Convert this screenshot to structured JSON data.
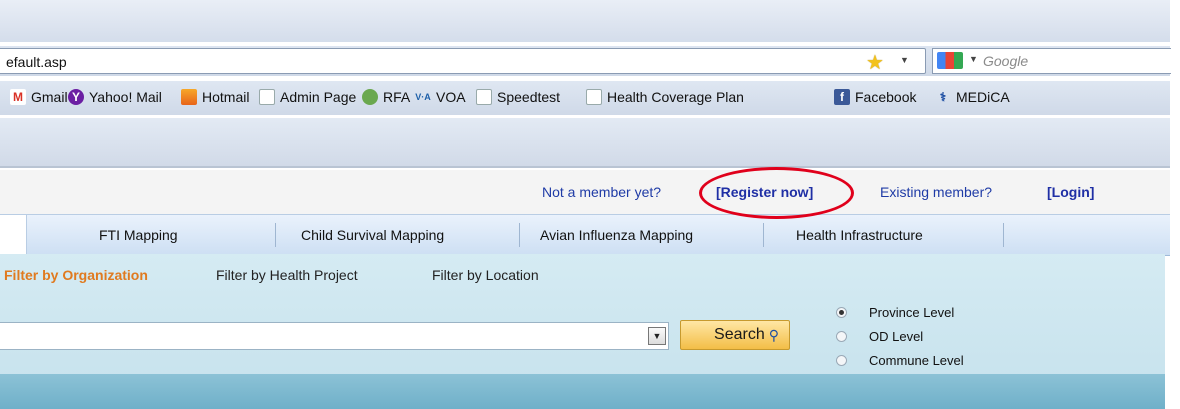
{
  "browser": {
    "address": "efault.asp",
    "search_placeholder": "Google"
  },
  "bookmarks": [
    {
      "label": "Gmail",
      "icon": "gmail-icon"
    },
    {
      "label": "Yahoo! Mail",
      "icon": "yahoo-icon"
    },
    {
      "label": "Hotmail",
      "icon": "hotmail-icon"
    },
    {
      "label": "Admin Page",
      "icon": "page-icon"
    },
    {
      "label": "RFA",
      "icon": "rfa-icon"
    },
    {
      "label": "VOA",
      "icon": "voa-icon"
    },
    {
      "label": "Speedtest",
      "icon": "page-icon"
    },
    {
      "label": "Health Coverage Plan",
      "icon": "page-icon"
    },
    {
      "label": "Facebook",
      "icon": "facebook-icon"
    },
    {
      "label": "MEDiCA",
      "icon": "medica-icon"
    }
  ],
  "member": {
    "not_member": "Not a member yet?",
    "register": "[Register now]",
    "existing": "Existing member?",
    "login": "[Login]"
  },
  "nav": {
    "tabs": [
      "FTI Mapping",
      "Child Survival Mapping",
      "Avian Influenza Mapping",
      "Health Infrastructure"
    ]
  },
  "filters": {
    "tabs": [
      "Filter by Organization",
      "Filter by Health Project",
      "Filter by Location"
    ],
    "active": "Filter by Organization"
  },
  "search": {
    "button_label": "Search"
  },
  "levels": {
    "options": [
      "Province Level",
      "OD Level",
      "Commune Level"
    ],
    "selected": "Province Level"
  },
  "colors": {
    "accent": "#e07a1f",
    "link": "#1f3ba6",
    "annotation": "#e0001b"
  }
}
